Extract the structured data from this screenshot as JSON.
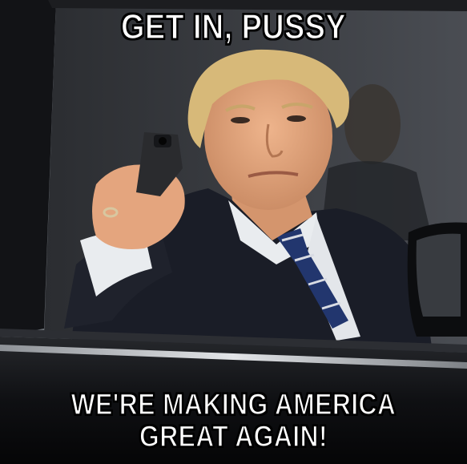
{
  "meme": {
    "top_text": "GET IN, PUSSY",
    "bottom_text": "WE'RE MAKING AMERICA GREAT AGAIN!"
  },
  "colors": {
    "car_body": "#0d0e10",
    "window_frame": "#1c1d20",
    "chrome_trim": "#b9bcc0",
    "suit": "#1a1d27",
    "shirt": "#e9ecef",
    "tie": "#22366e",
    "tie_stripe": "#d8dbe3",
    "skin": "#e4a57e",
    "hair": "#d7b979",
    "gun": "#2a2b2e",
    "background": "#7a7f86"
  }
}
